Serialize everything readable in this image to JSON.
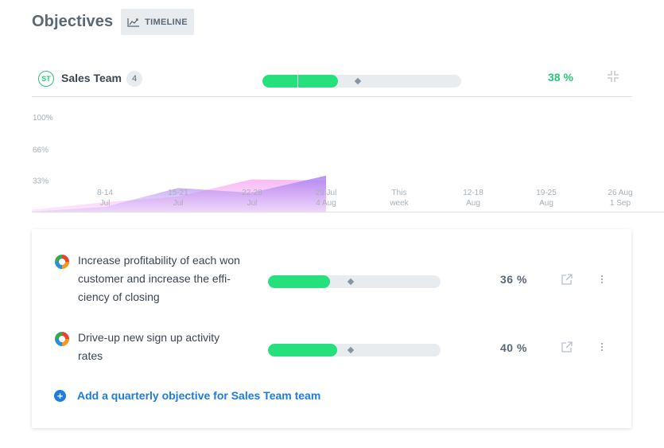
{
  "page": {
    "title": "Objectives"
  },
  "toolbar": {
    "timeline_label": "TIMELINE",
    "timeline_icon": "chart-line-icon"
  },
  "team": {
    "avatar": "ST",
    "name": "Sales Team",
    "count": "4",
    "progress": 0.38,
    "expected": 0.48,
    "percent": "38 %",
    "collapse_icon": "collapse-icon"
  },
  "chart_data": {
    "type": "area",
    "y_ticks": [
      "100%",
      "66%",
      "33%"
    ],
    "x_ticks": [
      {
        "l1": "8-14",
        "l2": "Jul"
      },
      {
        "l1": "15-21",
        "l2": "Jul"
      },
      {
        "l1": "22-28",
        "l2": "Jul"
      },
      {
        "l1": "29 Jul",
        "l2": "4 Aug"
      },
      {
        "l1": "This",
        "l2": "week"
      },
      {
        "l1": "12-18",
        "l2": "Aug"
      },
      {
        "l1": "19-25",
        "l2": "Aug"
      },
      {
        "l1": "26 Aug",
        "l2": "1 Sep"
      }
    ],
    "ylim": [
      0,
      100
    ],
    "series": [
      {
        "values": [
          2,
          10,
          16,
          34,
          33
        ],
        "color": "#f0a8f0"
      },
      {
        "values": [
          0,
          5,
          25,
          20,
          38
        ],
        "color": "#b48cf0"
      }
    ]
  },
  "objectives": [
    {
      "title_lines": [
        "Increase profitability of each won",
        "customer and increase the effi-",
        "ciency of closing"
      ],
      "progress": 0.36,
      "expected": 0.48,
      "percent": "36  %"
    },
    {
      "title_lines": [
        "Drive-up new sign up activity",
        "rates"
      ],
      "progress": 0.4,
      "expected": 0.48,
      "percent": "40  %"
    }
  ],
  "add_objective": {
    "label": "Add a quarterly objective for Sales Team team"
  },
  "colors": {
    "accent_green": "#26e07c",
    "link_blue": "#1e7be0",
    "text_muted": "#5a6775"
  }
}
